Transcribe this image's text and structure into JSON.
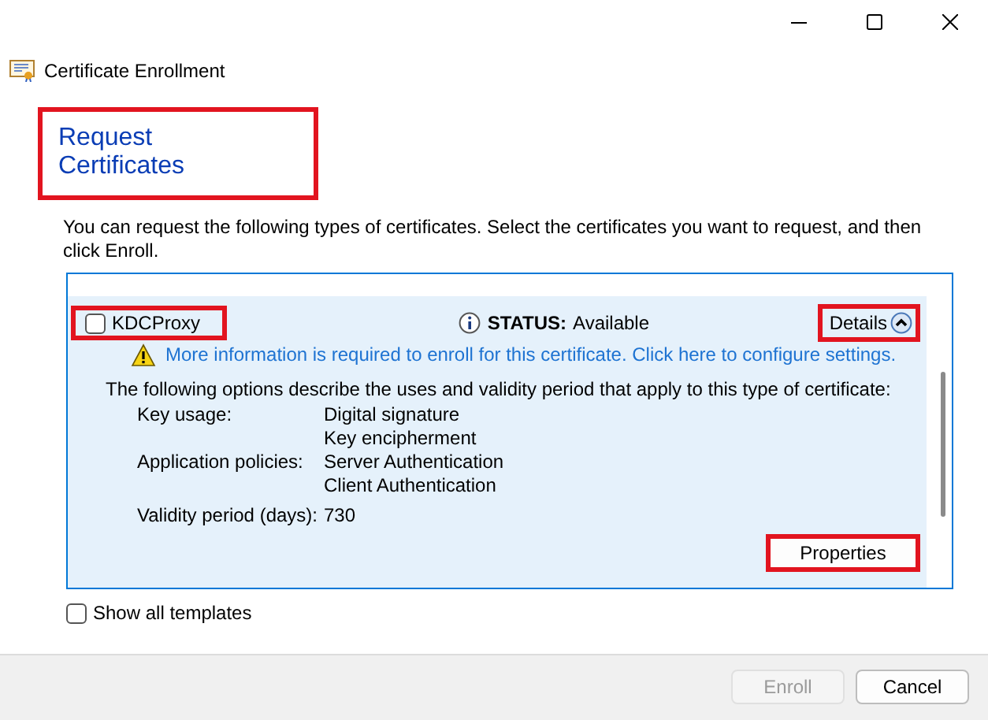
{
  "window": {
    "title": "Certificate Enrollment"
  },
  "heading": "Request Certificates",
  "description": "You can request the following types of certificates. Select the certificates you want to request, and then click Enroll.",
  "certificates": [
    {
      "name": "KDCProxy",
      "checked": false,
      "expanded": true,
      "status_label": "STATUS:",
      "status": "Available",
      "details_label": "Details",
      "warning": "More information is required to enroll for this certificate. Click here to configure settings.",
      "options_intro": "The following options describe the uses and validity period that apply to this type of certificate:",
      "options": [
        {
          "label": "Key usage:",
          "values": [
            "Digital signature",
            "Key encipherment"
          ]
        },
        {
          "label": "Application policies:",
          "values": [
            "Server Authentication",
            "Client Authentication"
          ]
        },
        {
          "label": "Validity period (days):",
          "values": [
            "730"
          ]
        }
      ],
      "properties_button": "Properties"
    }
  ],
  "show_all_templates": {
    "label": "Show all templates",
    "checked": false
  },
  "buttons": [
    {
      "label": "Enroll",
      "disabled": true
    },
    {
      "label": "Cancel",
      "disabled": false
    }
  ]
}
